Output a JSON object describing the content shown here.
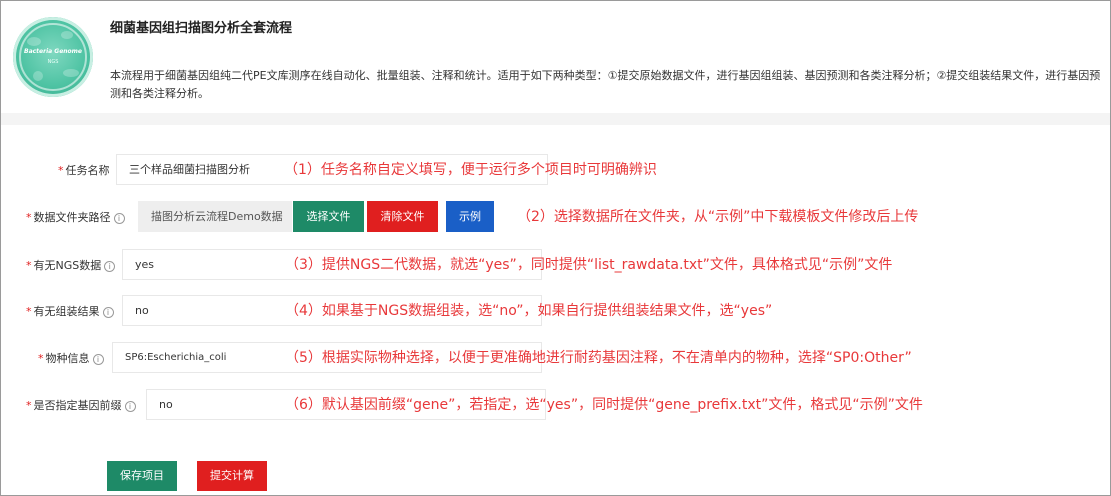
{
  "header": {
    "logo_text_main": "Bacteria Genome",
    "logo_text_sub": "NGS",
    "title": "细菌基因组扫描图分析全套流程",
    "description": "本流程用于细菌基因组纯二代PE文库测序在线自动化、批量组装、注释和统计。适用于如下两种类型：①提交原始数据文件，进行基因组组装、基因预测和各类注释分析；②提交组装结果文件，进行基因预测和各类注释分析。"
  },
  "form": {
    "task_name": {
      "label": "任务名称",
      "value": "三个样品细菌扫描图分析",
      "note": "（1）任务名称自定义填写，便于运行多个项目时可明确辨识"
    },
    "data_folder": {
      "label": "数据文件夹路径",
      "value": "描图分析云流程Demo数据",
      "select_button": "选择文件",
      "clear_button": "清除文件",
      "example_button": "示例",
      "note": "（2）选择数据所在文件夹，从“示例”中下载模板文件修改后上传"
    },
    "has_ngs": {
      "label": "有无NGS数据",
      "value": "yes",
      "note": "（3）提供NGS二代数据，就选“yes”，同时提供“list_rawdata.txt”文件，具体格式见“示例”文件"
    },
    "has_assembly": {
      "label": "有无组装结果",
      "value": "no",
      "note": "（4）如果基于NGS数据组装，选“no”，如果自行提供组装结果文件，选“yes”"
    },
    "species": {
      "label": "物种信息",
      "value": "SP6:Escherichia_coli",
      "note": "（5）根据实际物种选择，以便于更准确地进行耐药基因注释，不在清单内的物种，选择“SP0:Other”"
    },
    "gene_prefix": {
      "label": "是否指定基因前缀",
      "value": "no",
      "note": "（6）默认基因前缀“gene”，若指定，选“yes”，同时提供“gene_prefix.txt”文件，格式见“示例”文件"
    }
  },
  "actions": {
    "save_label": "保存项目",
    "submit_label": "提交计算"
  },
  "colors": {
    "accent_green": "#1e8a67",
    "accent_red": "#e01f1f",
    "accent_blue": "#1a5fc7",
    "note_red": "#e8383a"
  }
}
